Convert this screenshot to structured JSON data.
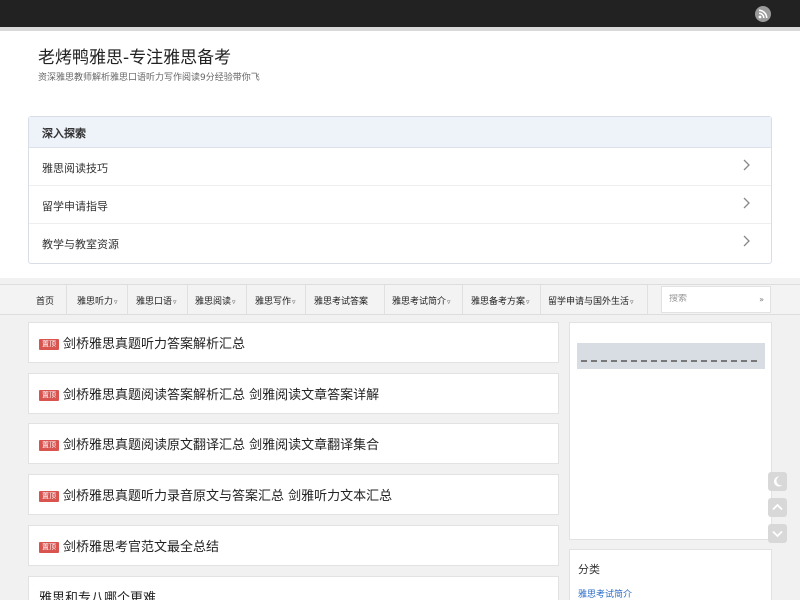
{
  "topbar": {
    "rss_icon": "rss-icon"
  },
  "site": {
    "title": "老烤鸭雅思-专注雅思备考",
    "description": "资深雅思教师解析雅思口语听力写作阅读9分经验带你飞"
  },
  "explore": {
    "heading": "深入探索",
    "items": [
      {
        "label": "雅思阅读技巧"
      },
      {
        "label": "留学申请指导"
      },
      {
        "label": "教学与教室资源"
      }
    ]
  },
  "nav": {
    "items": [
      {
        "label": "首页",
        "dropdown": false
      },
      {
        "label": "雅思听力",
        "dropdown": true
      },
      {
        "label": "雅思口语",
        "dropdown": true
      },
      {
        "label": "雅思阅读",
        "dropdown": true
      },
      {
        "label": "雅思写作",
        "dropdown": true
      },
      {
        "label": "雅思考试答案",
        "dropdown": false
      },
      {
        "label": "雅思考试简介",
        "dropdown": true
      },
      {
        "label": "雅思备考方案",
        "dropdown": true
      },
      {
        "label": "留学申请与国外生活",
        "dropdown": true
      }
    ],
    "search": {
      "placeholder": "搜索",
      "button": "»"
    }
  },
  "posts": {
    "badge": "置顶",
    "items": [
      {
        "title": "剑桥雅思真题听力答案解析汇总",
        "sticky": true
      },
      {
        "title": "剑桥雅思真题阅读答案解析汇总 剑雅阅读文章答案详解",
        "sticky": true
      },
      {
        "title": "剑桥雅思真题阅读原文翻译汇总 剑雅阅读文章翻译集合",
        "sticky": true
      },
      {
        "title": "剑桥雅思真题听力录音原文与答案汇总 剑雅听力文本汇总",
        "sticky": true
      },
      {
        "title": "剑桥雅思考官范文最全总结",
        "sticky": true
      },
      {
        "title": "雅思和专八哪个更难",
        "sticky": false
      }
    ]
  },
  "sidebar": {
    "categories_title": "分类",
    "first_category": "雅思考试简介"
  },
  "colors": {
    "badge": "#d9534f",
    "link": "#2a6cc7",
    "topbar": "#222222"
  }
}
